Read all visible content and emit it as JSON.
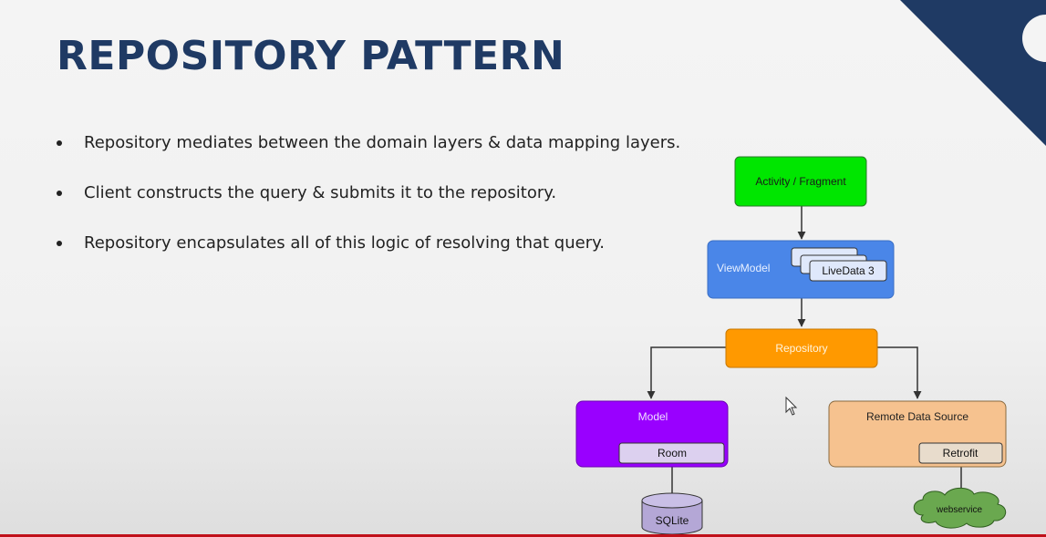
{
  "slide": {
    "title": "REPOSITORY PATTERN",
    "bullets": [
      "Repository mediates between the domain layers & data mapping layers.",
      "Client constructs the query & submits it to the repository.",
      "Repository encapsulates all of this logic of resolving that query."
    ]
  },
  "diagram": {
    "activity_fragment": "Activity / Fragment",
    "viewmodel": "ViewModel",
    "livedata": "LiveData 3",
    "repository": "Repository",
    "model": "Model",
    "room": "Room",
    "sqlite": "SQLite",
    "remote_data_source": "Remote Data Source",
    "retrofit": "Retrofit",
    "webservice": "webservice"
  },
  "colors": {
    "title": "#1f3a64",
    "corner_accent": "#1f3a64",
    "activity": "#00e600",
    "viewmodel": "#4a86e8",
    "repository": "#ff9900",
    "model": "#9900ff",
    "remote": "#f6c28f",
    "sqlite": "#b4a7d6",
    "webservice": "#6aa84f",
    "bottom_bar": "#c0101a"
  }
}
